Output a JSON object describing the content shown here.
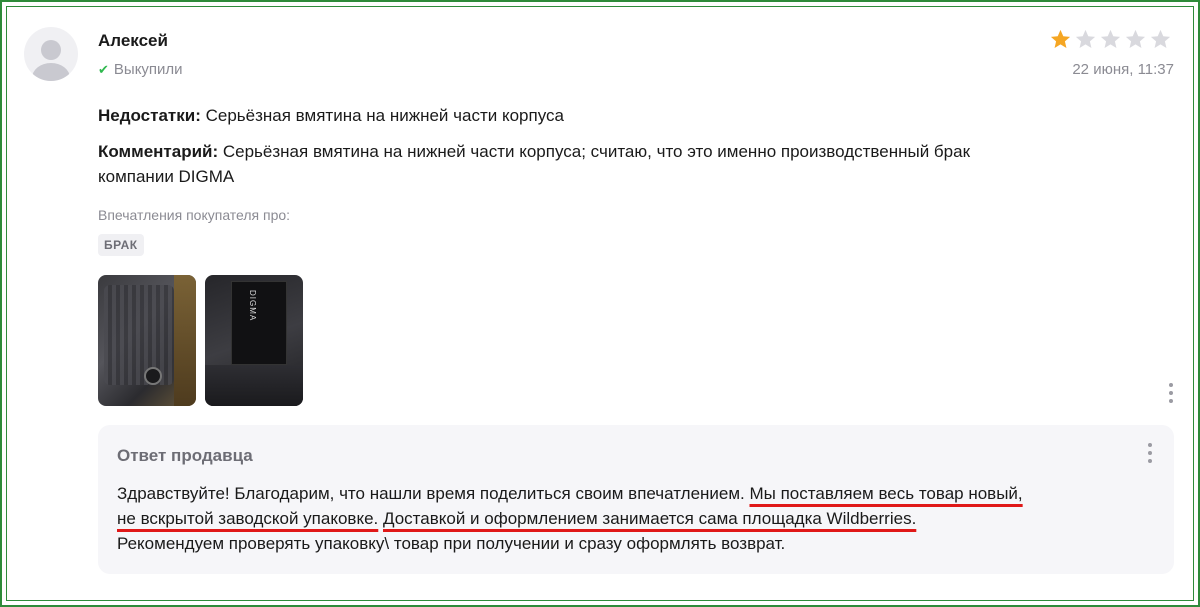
{
  "review": {
    "author": "Алексей",
    "bought_label": "Выкупили",
    "rating": 1,
    "rating_max": 5,
    "date": "22 июня, 11:37",
    "cons_label": "Недостатки:",
    "cons_text": "Серьёзная вмятина на нижней части корпуса",
    "comment_label": "Комментарий:",
    "comment_line1": "Серьёзная вмятина на нижней части корпуса; считаю, что это именно производственный брак",
    "comment_line2": "компании DIGMA",
    "impressions_label": "Впечатления покупателя про:",
    "tag": "БРАК",
    "photo2_brand": "DIGMA"
  },
  "reply": {
    "title": "Ответ продавца",
    "text_part1": "Здравствуйте! Благодарим, что нашли время поделиться своим впечатлением. ",
    "text_part2": "Мы поставляем весь товар новый,",
    "text_part3": "не вскрытой заводской упаковке.",
    "text_part4": " ",
    "text_part5": "Доставкой и оформлением занимается сама площадка Wildberries.",
    "text_part6": "Рекомендуем проверять упаковку\\ товар при получении и сразу оформлять возврат."
  },
  "colors": {
    "star_filled": "#f5a623",
    "star_empty": "#d9d9de",
    "frame": "#2e8b3a",
    "underline": "#e01818",
    "check": "#2fb84e"
  },
  "icons": {
    "avatar": "user-avatar-icon",
    "check": "check-icon",
    "star": "star-icon",
    "more": "more-vertical-icon"
  }
}
